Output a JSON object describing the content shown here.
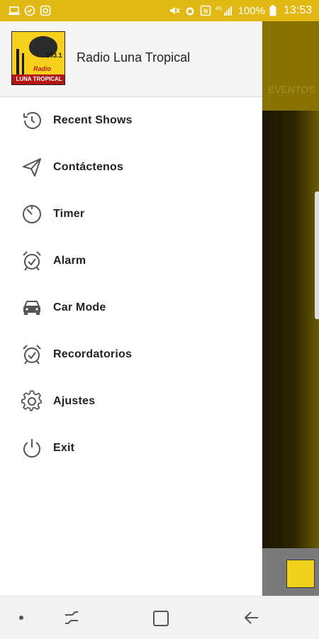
{
  "status_bar": {
    "battery_percent": "100%",
    "time": "13:53"
  },
  "drawer": {
    "app_title": "Radio Luna Tropical",
    "logo": {
      "freq_text": "103.1",
      "radio_text": "Radio",
      "band_text": "LUNA TROPICAL"
    },
    "menu_items": [
      {
        "label": "Recent Shows",
        "icon": "history-icon"
      },
      {
        "label": "Contáctenos",
        "icon": "send-icon"
      },
      {
        "label": "Timer",
        "icon": "timer-icon"
      },
      {
        "label": "Alarm",
        "icon": "alarm-icon"
      },
      {
        "label": "Car Mode",
        "icon": "car-icon"
      },
      {
        "label": "Recordatorios",
        "icon": "alarm-check-icon"
      },
      {
        "label": "Ajustes",
        "icon": "gear-icon"
      },
      {
        "label": "Exit",
        "icon": "power-icon"
      }
    ]
  },
  "background_app": {
    "tab_label": "EVENTOS"
  },
  "colors": {
    "status_bar": "#e2b814",
    "toolbar_dim": "#8a7200",
    "icon": "#555555"
  }
}
